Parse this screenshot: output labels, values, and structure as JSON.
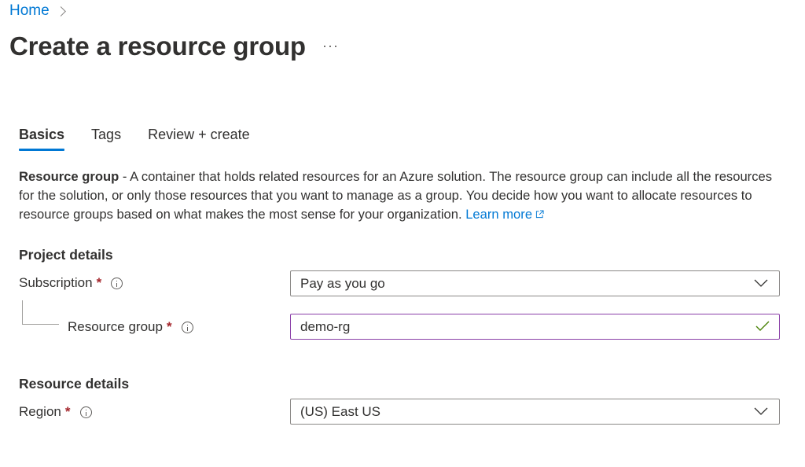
{
  "breadcrumb": {
    "items": [
      "Home"
    ]
  },
  "page": {
    "title": "Create a resource group",
    "more_label": "···"
  },
  "tabs": [
    {
      "label": "Basics",
      "active": true
    },
    {
      "label": "Tags",
      "active": false
    },
    {
      "label": "Review + create",
      "active": false
    }
  ],
  "description": {
    "bold": "Resource group",
    "text": " - A container that holds related resources for an Azure solution. The resource group can include all the resources for the solution, or only those resources that you want to manage as a group. You decide how you want to allocate resources to resource groups based on what makes the most sense for your organization. ",
    "link": "Learn more"
  },
  "project_details": {
    "heading": "Project details",
    "subscription": {
      "label": "Subscription",
      "required": "*",
      "value": "Pay as you go"
    },
    "resource_group": {
      "label": "Resource group",
      "required": "*",
      "value": "demo-rg"
    }
  },
  "resource_details": {
    "heading": "Resource details",
    "region": {
      "label": "Region",
      "required": "*",
      "value": "(US) East US"
    }
  },
  "colors": {
    "accent": "#0078d4",
    "required": "#a4262c",
    "valid_border": "#8a3fa8",
    "check": "#498205"
  }
}
